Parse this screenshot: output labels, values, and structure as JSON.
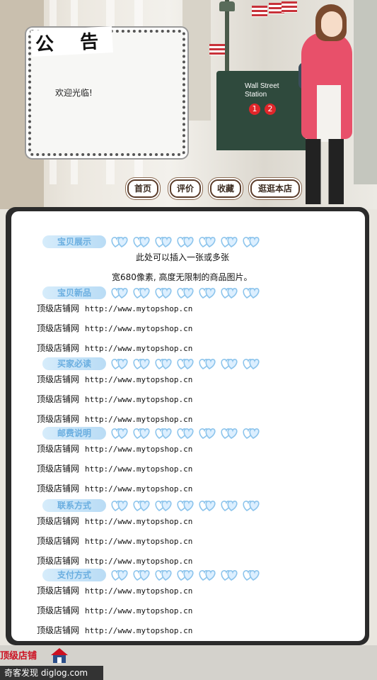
{
  "notice": {
    "title": "公 告",
    "text": "欢迎光临!"
  },
  "nav": [
    {
      "label": "首页"
    },
    {
      "label": "评价"
    },
    {
      "label": "收藏"
    },
    {
      "label": "逛逛本店"
    }
  ],
  "banner": {
    "station_sign": "Wall Street\nStation",
    "lines": [
      "1",
      "2"
    ]
  },
  "sections": [
    {
      "tag": "宝贝展示",
      "lines": []
    },
    {
      "tag": "宝贝新品",
      "lines": [
        {
          "name": "顶级店铺网",
          "url": "http://www.mytopshop.cn"
        },
        {
          "name": "顶级店铺网",
          "url": "http://www.mytopshop.cn"
        },
        {
          "name": "顶级店铺网",
          "url": "http://www.mytopshop.cn"
        }
      ]
    },
    {
      "tag": "买家必读",
      "lines": [
        {
          "name": "顶级店铺网",
          "url": "http://www.mytopshop.cn"
        },
        {
          "name": "顶级店铺网",
          "url": "http://www.mytopshop.cn"
        },
        {
          "name": "顶级店铺网",
          "url": "http://www.mytopshop.cn"
        }
      ]
    },
    {
      "tag": "邮费说明",
      "lines": [
        {
          "name": "顶级店铺网",
          "url": "http://www.mytopshop.cn"
        },
        {
          "name": "顶级店铺网",
          "url": "http://www.mytopshop.cn"
        },
        {
          "name": "顶级店铺网",
          "url": "http://www.mytopshop.cn"
        }
      ]
    },
    {
      "tag": "联系方式",
      "lines": [
        {
          "name": "顶级店铺网",
          "url": "http://www.mytopshop.cn"
        },
        {
          "name": "顶级店铺网",
          "url": "http://www.mytopshop.cn"
        },
        {
          "name": "顶级店铺网",
          "url": "http://www.mytopshop.cn"
        }
      ]
    },
    {
      "tag": "支付方式",
      "lines": [
        {
          "name": "顶级店铺网",
          "url": "http://www.mytopshop.cn"
        },
        {
          "name": "顶级店铺网",
          "url": "http://www.mytopshop.cn"
        },
        {
          "name": "顶级店铺网",
          "url": "http://www.mytopshop.cn"
        }
      ]
    }
  ],
  "intro": {
    "line1": "此处可以插入一张或多张",
    "line2": "宽680像素, 高度无限制的商品图片。"
  },
  "footer": {
    "logo": "顶级店铺",
    "watermark": "奇客发现 diglog.com"
  },
  "colors": {
    "panel_border": "#2b2b2b",
    "tag_text": "#6aaee0",
    "coat": "#e8506a"
  }
}
